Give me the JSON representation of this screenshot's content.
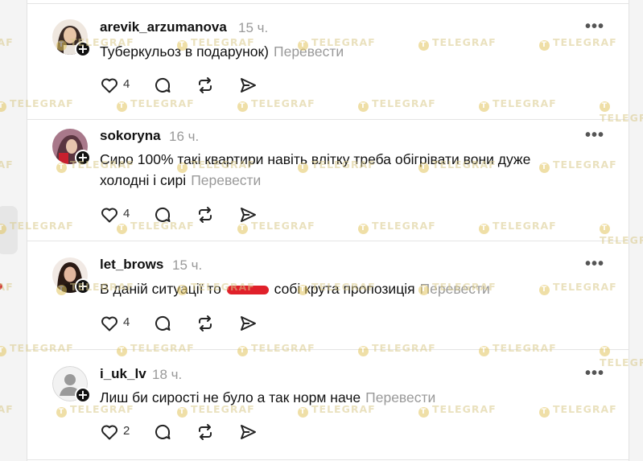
{
  "posts": [
    {
      "username": "arevik_arzumanova",
      "time": "15 ч.",
      "text": "Туберкульоз в подарунок)",
      "translate": "Перевести",
      "likes": "4",
      "avatar_color": "#3a2b26"
    },
    {
      "username": "sokoryna",
      "time": "16 ч.",
      "text": "Сиро 100% такі квартири навіть влітку треба обігрівати вони дуже холодні і сирі",
      "translate": "Перевести",
      "likes": "4",
      "avatar_color": "#7a4a5a"
    },
    {
      "username": "let_brows",
      "time": "15 ч.",
      "text_before": "В даній ситуації то",
      "text_after": "собі крута пропозиція",
      "translate": "Перевести",
      "likes": "4",
      "avatar_color": "#2b1a14"
    },
    {
      "username": "i_uk_lv",
      "time": "18 ч.",
      "text": "Лиш би сирості не було а так норм наче",
      "translate": "Перевести",
      "likes": "2",
      "avatar_color": "#d9d9d9"
    }
  ],
  "icons": {
    "more": "more-horizontal-icon",
    "like": "heart-icon",
    "reply": "comment-icon",
    "repost": "repost-icon",
    "share": "send-icon",
    "follow": "plus-icon"
  },
  "watermark": "TELEGRAF"
}
